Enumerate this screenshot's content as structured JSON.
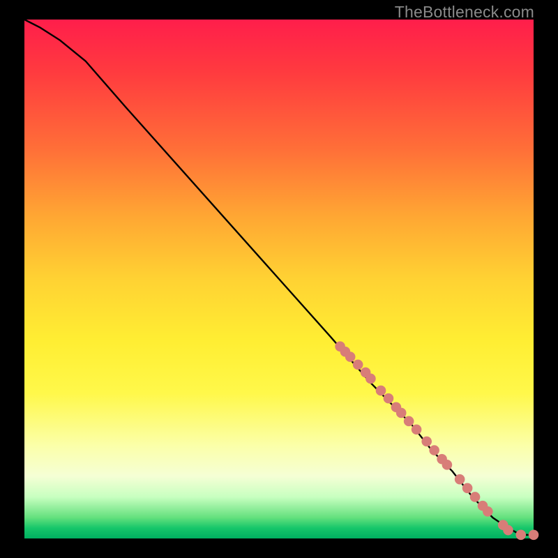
{
  "watermark": "TheBottleneck.com",
  "chart_data": {
    "type": "line",
    "title": "",
    "xlabel": "",
    "ylabel": "",
    "xlim": [
      0,
      100
    ],
    "ylim": [
      0,
      100
    ],
    "curve": {
      "name": "bottleneck-curve",
      "x": [
        0,
        3,
        7,
        12,
        20,
        30,
        40,
        50,
        60,
        68,
        72,
        76,
        80,
        84,
        88,
        92,
        95,
        97.5,
        100
      ],
      "y": [
        100,
        98.5,
        96,
        92,
        83,
        72,
        61,
        50,
        39,
        30,
        26,
        22,
        17,
        13,
        8,
        4,
        2,
        0.7,
        0.7
      ]
    },
    "points": {
      "name": "data-points",
      "color": "#d87d78",
      "radius_pct": 1.0,
      "items": [
        {
          "x": 62,
          "y": 37
        },
        {
          "x": 63,
          "y": 36
        },
        {
          "x": 64,
          "y": 35
        },
        {
          "x": 65.5,
          "y": 33.5
        },
        {
          "x": 67,
          "y": 32
        },
        {
          "x": 68,
          "y": 30.8
        },
        {
          "x": 70,
          "y": 28.5
        },
        {
          "x": 71.5,
          "y": 27
        },
        {
          "x": 73,
          "y": 25.3
        },
        {
          "x": 74,
          "y": 24.2
        },
        {
          "x": 75.5,
          "y": 22.6
        },
        {
          "x": 77,
          "y": 21
        },
        {
          "x": 79,
          "y": 18.7
        },
        {
          "x": 80.5,
          "y": 17
        },
        {
          "x": 82,
          "y": 15.3
        },
        {
          "x": 83,
          "y": 14.2
        },
        {
          "x": 85.5,
          "y": 11.4
        },
        {
          "x": 87,
          "y": 9.7
        },
        {
          "x": 88.5,
          "y": 8
        },
        {
          "x": 90,
          "y": 6.3
        },
        {
          "x": 91,
          "y": 5.2
        },
        {
          "x": 94,
          "y": 2.6
        },
        {
          "x": 95,
          "y": 1.6
        },
        {
          "x": 97.5,
          "y": 0.7
        },
        {
          "x": 100,
          "y": 0.7
        }
      ]
    }
  }
}
